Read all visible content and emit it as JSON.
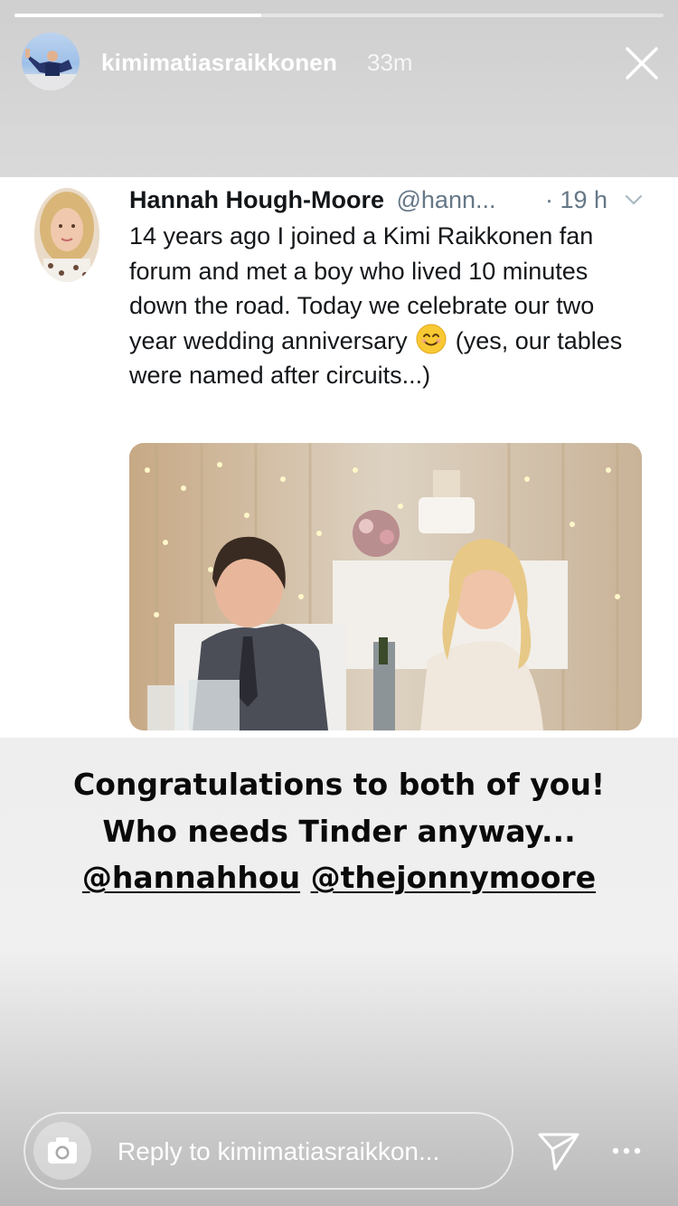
{
  "story": {
    "progress": 0.38,
    "username": "kimimatiasraikkonen",
    "time": "33m",
    "close_icon": "close-icon"
  },
  "tweet": {
    "name": "Hannah Hough-Moore",
    "handle": "@hann...",
    "time": "· 19 h",
    "text_before_emoji": "14 years ago I joined a Kimi Raikkonen fan forum and met a boy who lived 10 minutes down the road. Today we celebrate our two year wedding anniversary",
    "emoji": "smiling-face-emoji",
    "text_after_emoji": "(yes, our tables were named after circuits...)"
  },
  "caption": {
    "line1": "Congratulations to both of you!",
    "line2": "Who needs Tinder anyway...",
    "mention1": "@hannahhou",
    "mention2": "@thejonnymoore"
  },
  "footer": {
    "reply_placeholder": "Reply to kimimatiasraikkon...",
    "camera_icon": "camera-icon",
    "send_icon": "send-icon",
    "more_icon": "more-icon"
  },
  "colors": {
    "handle_gray": "#657786",
    "text_dark": "#14171a",
    "white": "#ffffff"
  }
}
